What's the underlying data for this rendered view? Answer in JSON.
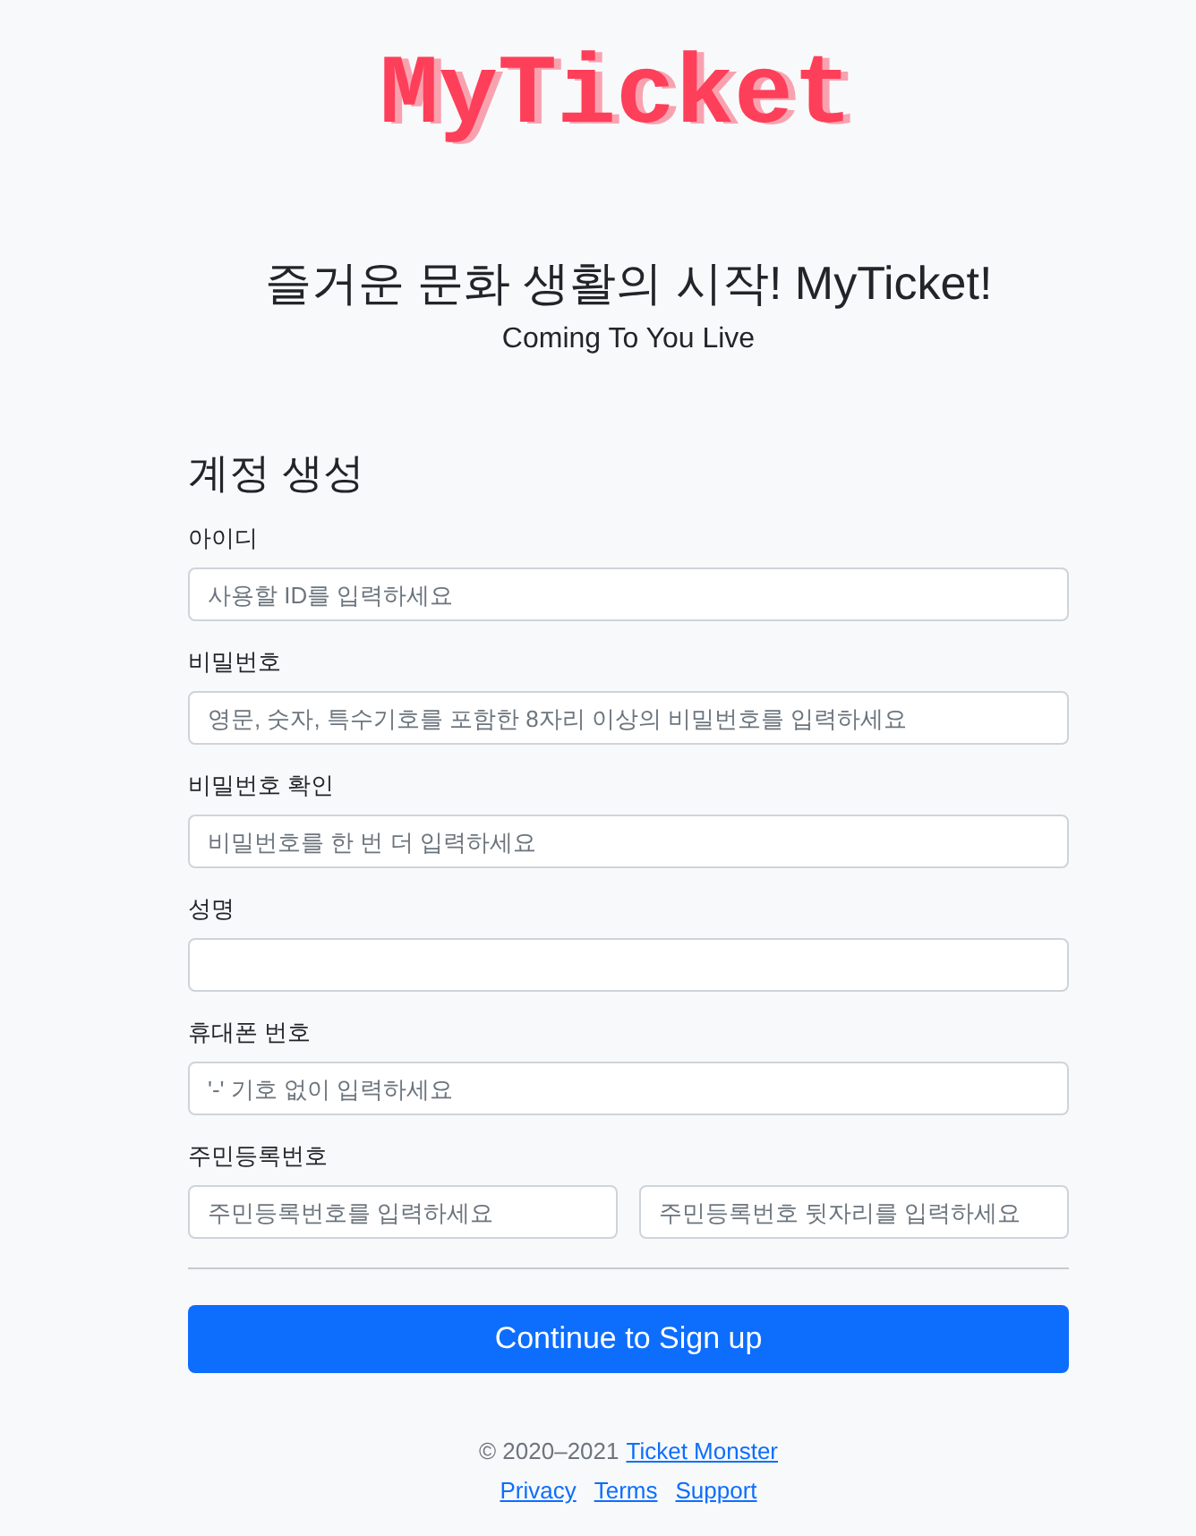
{
  "logo": {
    "text": "MyTicket"
  },
  "hero": {
    "title": "즐거운 문화 생활의 시작! MyTicket!",
    "subtitle": "Coming To You Live"
  },
  "form": {
    "title": "계정 생성",
    "fields": [
      {
        "label": "아이디",
        "inputs": [
          {
            "placeholder": "사용할 ID를 입력하세요"
          }
        ]
      },
      {
        "label": "비밀번호",
        "inputs": [
          {
            "placeholder": "영문, 숫자, 특수기호를 포함한 8자리 이상의 비밀번호를 입력하세요"
          }
        ]
      },
      {
        "label": "비밀번호 확인",
        "inputs": [
          {
            "placeholder": "비밀번호를 한 번 더 입력하세요"
          }
        ]
      },
      {
        "label": "성명"
      },
      {
        "label": "휴대폰 번호",
        "inputs": [
          {
            "placeholder": "'-' 기호 없이 입력하세요"
          }
        ]
      },
      {
        "label": "주민등록번호",
        "inputs": [
          {
            "placeholder": "주민등록번호를 입력하세요"
          },
          {
            "placeholder": "주민등록번호 뒷자리를 입력하세요"
          }
        ]
      }
    ],
    "submit_button": {
      "label": "Continue to Sign up"
    }
  },
  "footer": {
    "copyright": "© 2020–2021",
    "owner_link": "Ticket Monster",
    "links": [
      "Privacy",
      "Terms",
      "Support"
    ]
  }
}
